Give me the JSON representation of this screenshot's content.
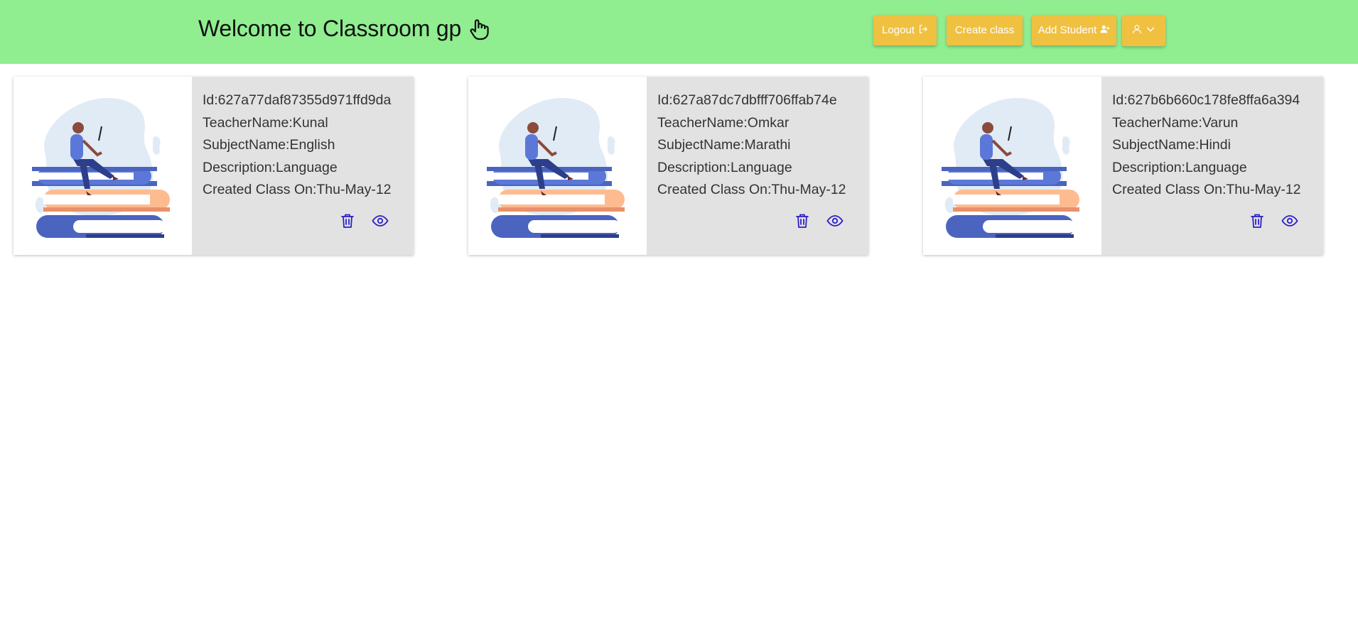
{
  "header": {
    "title": "Welcome to Classroom gp",
    "title_icon": "hand-pointer-icon",
    "logout_label": "Logout",
    "create_label": "Create class",
    "add_student_label": "Add Student",
    "user_menu_icon": "user-icon"
  },
  "colors": {
    "navbar": "#90ee90",
    "button": "#f0c040",
    "card_bg": "#e2e2e2",
    "action_icon": "#2a1fc9"
  },
  "classes": [
    {
      "id": "Id:627a77daf87355d971ffd9da",
      "teacher": "TeacherName:Kunal",
      "subject": "SubjectName:English",
      "description": "Description:Language",
      "created": "Created Class On:Thu-May-12"
    },
    {
      "id": "Id:627a87dc7dbfff706ffab74e",
      "teacher": "TeacherName:Omkar",
      "subject": "SubjectName:Marathi",
      "description": "Description:Language",
      "created": "Created Class On:Thu-May-12"
    },
    {
      "id": "Id:627b6b660c178fe8ffa6a394",
      "teacher": "TeacherName:Varun",
      "subject": "SubjectName:Hindi",
      "description": "Description:Language",
      "created": "Created Class On:Thu-May-12"
    }
  ]
}
